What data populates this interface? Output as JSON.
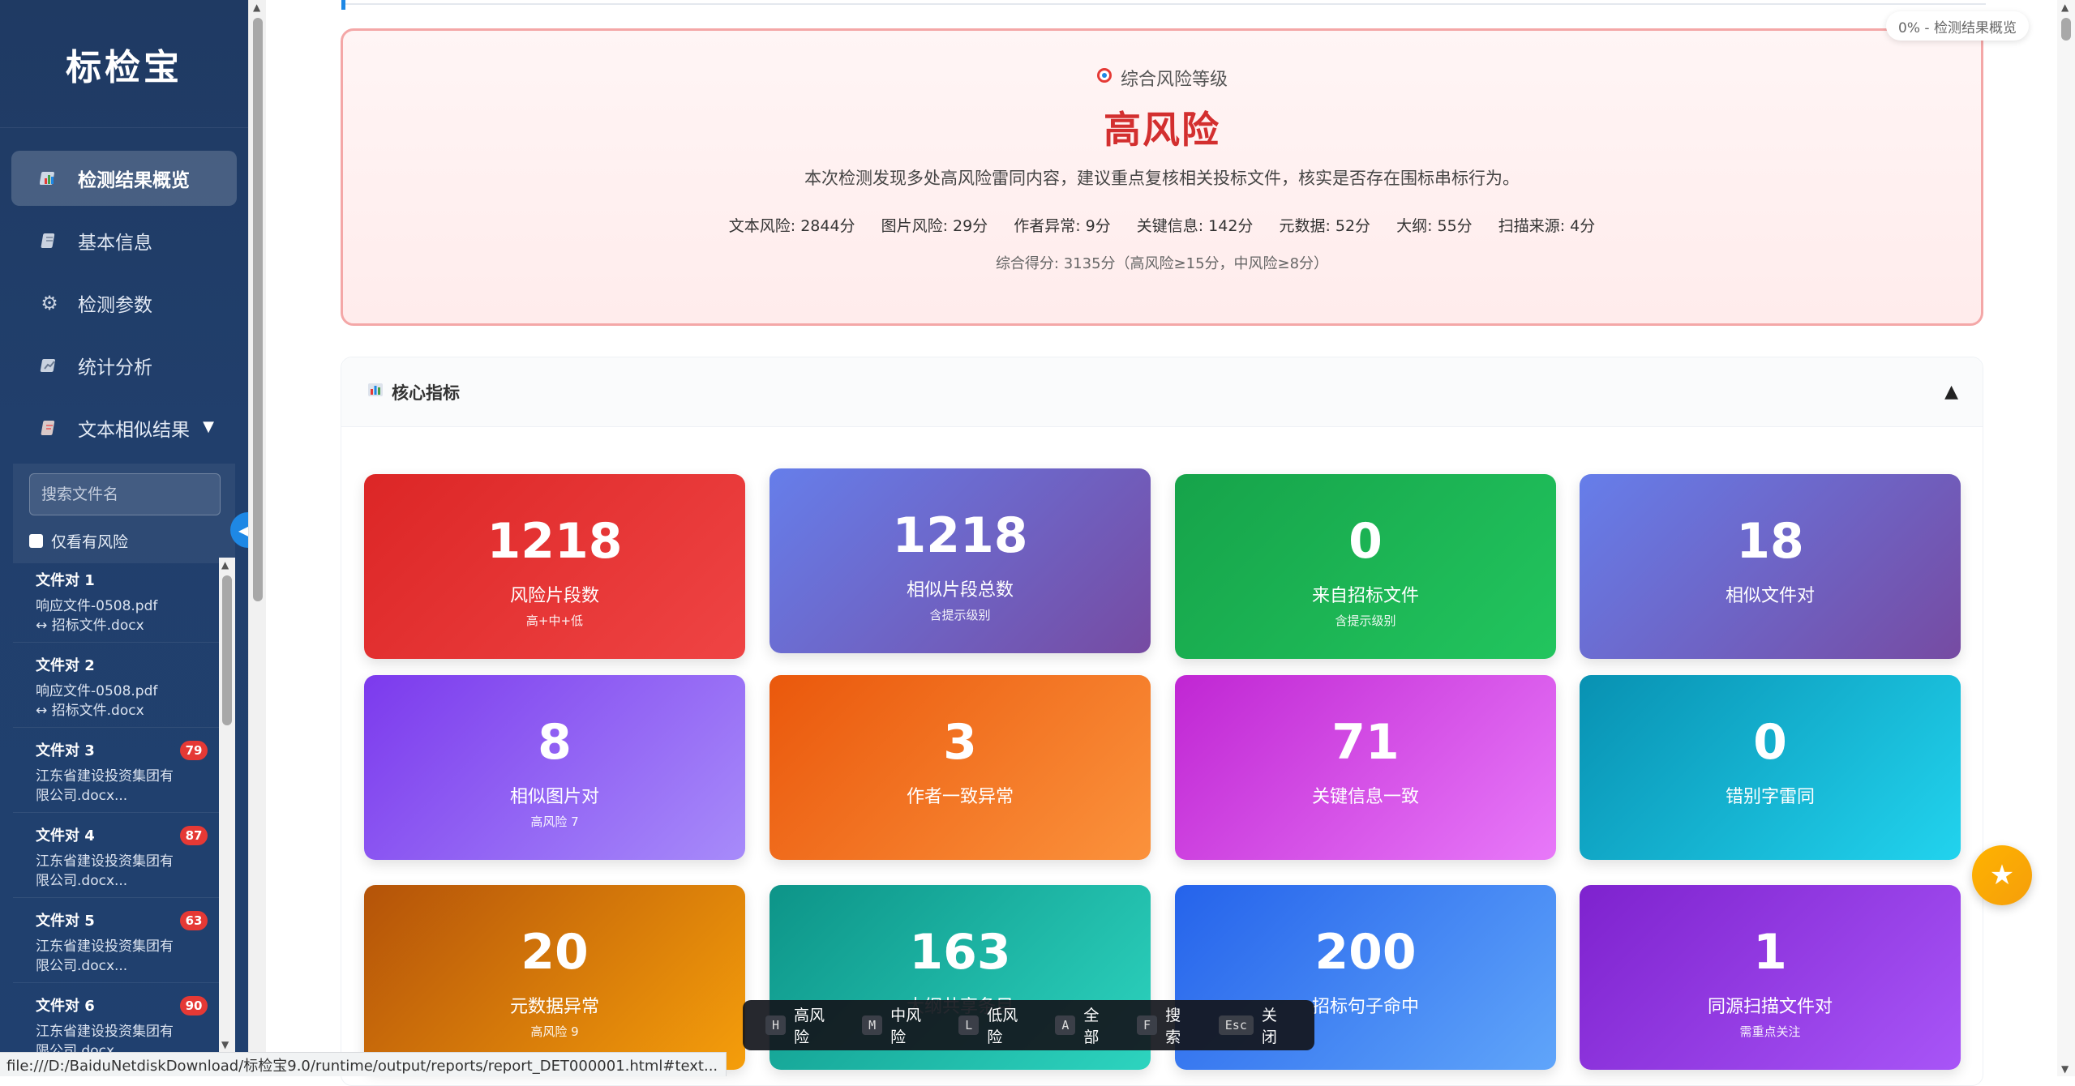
{
  "sidebar": {
    "brand": "标检宝",
    "nav": [
      {
        "label": "检测结果概览",
        "icon": "chart-icon",
        "active": true
      },
      {
        "label": "基本信息",
        "icon": "doc-icon"
      },
      {
        "label": "检测参数",
        "icon": "gear-icon"
      },
      {
        "label": "统计分析",
        "icon": "stats-icon"
      },
      {
        "label": "文本相似结果",
        "icon": "text-icon",
        "caret": "▼"
      }
    ],
    "search_placeholder": "搜索文件名",
    "risk_only_label": "仅看有风险",
    "files": [
      {
        "title": "文件对 1",
        "line1": "响应文件-0508.pdf",
        "line2": "↔ 招标文件.docx",
        "badge": ""
      },
      {
        "title": "文件对 2",
        "line1": "响应文件-0508.pdf",
        "line2": "↔ 招标文件.docx",
        "badge": ""
      },
      {
        "title": "文件对 3",
        "line1": "江东省建设投资集团有",
        "line2": "限公司.docx...",
        "badge": "79"
      },
      {
        "title": "文件对 4",
        "line1": "江东省建设投资集团有",
        "line2": "限公司.docx...",
        "badge": "87"
      },
      {
        "title": "文件对 5",
        "line1": "江东省建设投资集团有",
        "line2": "限公司.docx...",
        "badge": "63"
      },
      {
        "title": "文件对 6",
        "line1": "江东省建设投资集团有",
        "line2": "限公司.docx...",
        "badge": "90"
      }
    ]
  },
  "progress_tag": "0% - 检测结果概览",
  "risk": {
    "label": "综合风险等级",
    "level": "高风险",
    "description": "本次检测发现多处高风险雷同内容，建议重点复核相关投标文件，核实是否存在围标串标行为。",
    "scores": [
      "文本风险: 2844分",
      "图片风险: 29分",
      "作者异常: 9分",
      "关键信息: 142分",
      "元数据: 52分",
      "大纲: 55分",
      "扫描来源: 4分"
    ],
    "total": "综合得分: 3135分（高风险≥15分，中风险≥8分）"
  },
  "metrics": {
    "title": "核心指标",
    "toggle": "▲",
    "cards": [
      {
        "num": "1218",
        "label": "风险片段数",
        "sub": "高+中+低"
      },
      {
        "num": "1218",
        "label": "相似片段总数",
        "sub": "含提示级别"
      },
      {
        "num": "0",
        "label": "来自招标文件",
        "sub": "含提示级别"
      },
      {
        "num": "18",
        "label": "相似文件对",
        "sub": ""
      },
      {
        "num": "8",
        "label": "相似图片对",
        "sub": "高风险 7"
      },
      {
        "num": "3",
        "label": "作者一致异常",
        "sub": ""
      },
      {
        "num": "71",
        "label": "关键信息一致",
        "sub": ""
      },
      {
        "num": "0",
        "label": "错别字雷同",
        "sub": ""
      },
      {
        "num": "20",
        "label": "元数据异常",
        "sub": "高风险 9"
      },
      {
        "num": "163",
        "label": "大纲共享条目",
        "sub": ""
      },
      {
        "num": "200",
        "label": "招标句子命中",
        "sub": ""
      },
      {
        "num": "1",
        "label": "同源扫描文件对",
        "sub": "需重点关注"
      }
    ],
    "card_colors": [
      [
        "#dc2626",
        "#ef4444"
      ],
      [
        "#667eea",
        "#764ba2"
      ],
      [
        "#16a34a",
        "#22c55e"
      ],
      [
        "#667eea",
        "#764ba2"
      ],
      [
        "#7c3aed",
        "#a78bfa"
      ],
      [
        "#ea580c",
        "#fb923c"
      ],
      [
        "#c026d3",
        "#e879f9"
      ],
      [
        "#0891b2",
        "#22d3ee"
      ],
      [
        "#b45309",
        "#f59e0b"
      ],
      [
        "#0d9488",
        "#2dd4bf"
      ],
      [
        "#2563eb",
        "#60a5fa"
      ],
      [
        "#7e22ce",
        "#a855f7"
      ]
    ]
  },
  "shortcuts": [
    {
      "key": "H",
      "label": "高风险"
    },
    {
      "key": "M",
      "label": "中风险"
    },
    {
      "key": "L",
      "label": "低风险"
    },
    {
      "key": "A",
      "label": "全部"
    },
    {
      "key": "F",
      "label": "搜索"
    },
    {
      "key": "Esc",
      "label": "关闭"
    }
  ],
  "status_url": "file:///D:/BaiduNetdiskDownload/标检宝9.0/runtime/output/reports/report_DET000001.html#text..."
}
